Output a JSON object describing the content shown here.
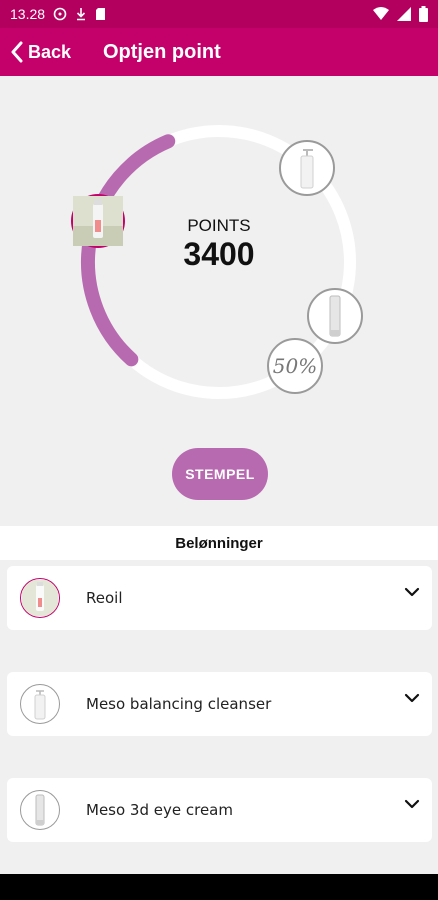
{
  "status_bar": {
    "time": "13.28"
  },
  "app_bar": {
    "back_label": "Back",
    "title": "Optjen point"
  },
  "points": {
    "label": "POINTS",
    "value": "3400",
    "progress_fraction": 0.32
  },
  "milestones": [
    {
      "icon": "serum-bottle-icon",
      "reached": true
    },
    {
      "icon": "pump-bottle-icon",
      "reached": false
    },
    {
      "icon": "tube-icon",
      "reached": false
    },
    {
      "icon": "discount-badge",
      "text": "50%",
      "reached": false
    }
  ],
  "stamp_button": {
    "label": "STEMPEL"
  },
  "rewards": {
    "header": "Belønninger",
    "items": [
      {
        "name": "Reoil",
        "icon": "serum-bottle-icon",
        "reached": true
      },
      {
        "name": "Meso balancing cleanser",
        "icon": "pump-bottle-icon",
        "reached": false
      },
      {
        "name": "Meso 3d eye cream",
        "icon": "tube-icon",
        "reached": false
      }
    ]
  },
  "colors": {
    "brand": "#c4006b",
    "accent": "#b86ab1",
    "progress": "#b86ab1"
  }
}
